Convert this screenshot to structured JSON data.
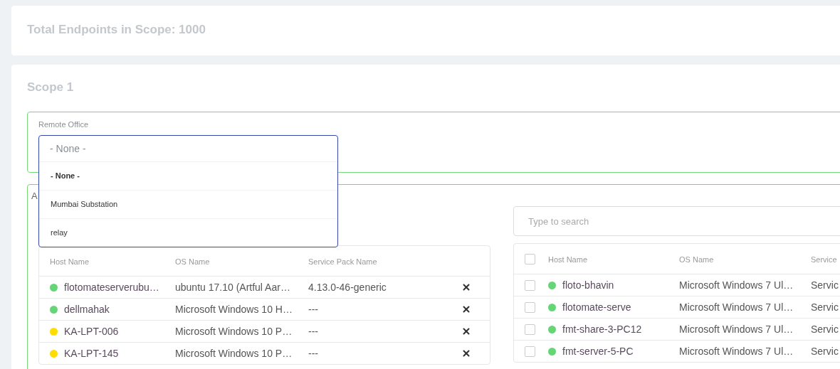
{
  "summary": {
    "title": "Total Endpoints in Scope: 1000"
  },
  "scope": {
    "title": "Scope 1",
    "remote_office": {
      "label": "Remote Office",
      "value": "- None -",
      "expanded": true,
      "options": [
        {
          "label": "- None -",
          "selected": true
        },
        {
          "label": "Mumbai Substation",
          "selected": false
        },
        {
          "label": "relay",
          "selected": false
        }
      ]
    },
    "section_label": "A",
    "assigned_table": {
      "columns": [
        "Host Name",
        "OS Name",
        "Service Pack Name"
      ],
      "rows": [
        {
          "host": "flotomateserverubu…",
          "color": "#66d575",
          "os": "ubuntu 17.10 (Artful Aar…",
          "service_pack": "4.13.0-46-generic"
        },
        {
          "host": "dellmahak",
          "color": "#66d575",
          "os": "Microsoft Windows 10 H…",
          "service_pack": "---"
        },
        {
          "host": "KA-LPT-006",
          "color": "#ffdd00",
          "os": "Microsoft Windows 10 P…",
          "service_pack": "---"
        },
        {
          "host": "KA-LPT-145",
          "color": "#ffdd00",
          "os": "Microsoft Windows 10 P…",
          "service_pack": "---"
        }
      ]
    },
    "search": {
      "placeholder": "Type to search"
    },
    "available_table": {
      "header_checked": false,
      "columns": [
        "Host Name",
        "OS Name",
        "Service"
      ],
      "rows": [
        {
          "checked": false,
          "host": "floto-bhavin",
          "color": "#66d575",
          "os": "Microsoft Windows 7 Ul…",
          "service_pack": "Servic"
        },
        {
          "checked": false,
          "host": "flotomate-serve",
          "color": "#66d575",
          "os": "Microsoft Windows 7 Ul…",
          "service_pack": "Servic"
        },
        {
          "checked": false,
          "host": "fmt-share-3-PC12",
          "color": "#66d575",
          "os": "Microsoft Windows 7 Ul…",
          "service_pack": "Servic"
        },
        {
          "checked": false,
          "host": "fmt-server-5-PC",
          "color": "#66d575",
          "os": "Microsoft Windows 7 Ul…",
          "service_pack": "Servic"
        }
      ]
    }
  }
}
